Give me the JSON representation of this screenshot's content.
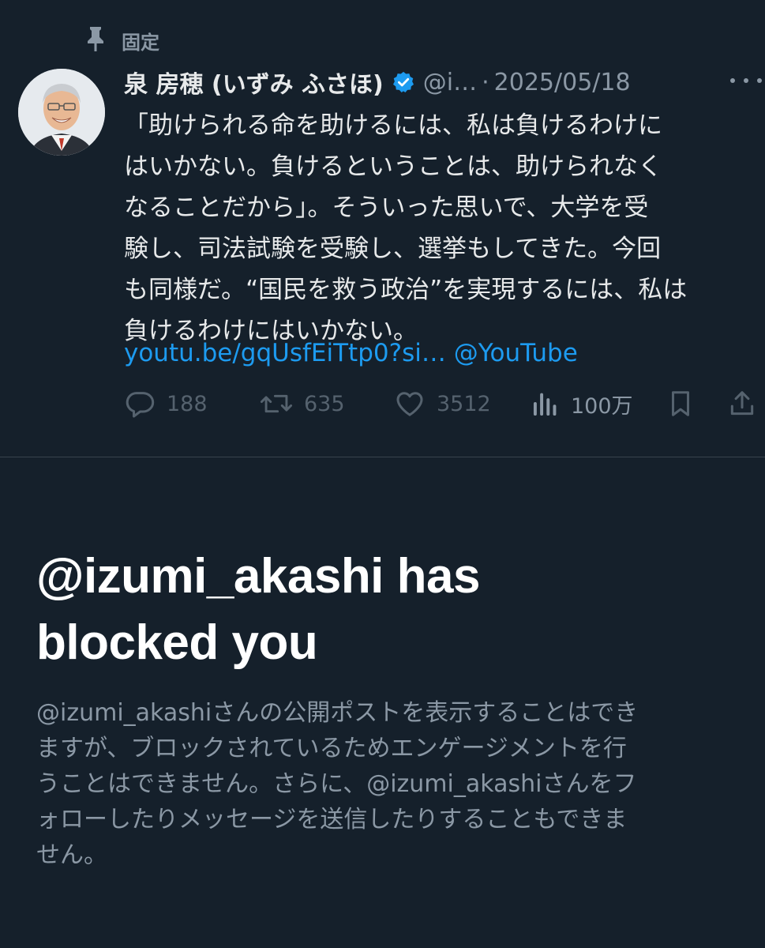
{
  "pinned": {
    "label": "固定",
    "icon": "pin-icon"
  },
  "tweet": {
    "display_name": "泉 房穂 (いずみ ふさほ)",
    "handle": "@i…",
    "separator": "·",
    "date": "2025/05/18",
    "verified_color": "#1d9bf0",
    "body_lines": [
      "「助けられる命を助けるには、私は負けるわけに",
      "はいかない。負けるということは、助けられなく",
      "なることだから」。そういった思いで、大学を受",
      "験し、司法試験を受験し、選挙もしてきた。今回",
      "も同様だ。“国民を救う政治”を実現するには、私は",
      "負けるわけにはいかない。"
    ],
    "link_text": "youtu.be/gqUsfEiTtp0?si…",
    "link_mention": "@YouTube",
    "actions": {
      "replies": "188",
      "retweets": "635",
      "likes": "3512",
      "views": "100万"
    }
  },
  "blocked": {
    "title_lines": [
      "@izumi_akashi has",
      "blocked you"
    ],
    "desc_lines": [
      "@izumi_akashiさんの公開ポストを表示することはでき",
      "ますが、ブロックされているためエンゲージメントを行",
      "うことはできません。さらに、@izumi_akashiさんをフ",
      "ォローしたりメッセージを送信したりすることもできま",
      "せん。"
    ]
  },
  "colors": {
    "background": "#15202b",
    "text": "#e7e9ea",
    "muted": "#8b98a5",
    "accent": "#1d9bf0"
  }
}
